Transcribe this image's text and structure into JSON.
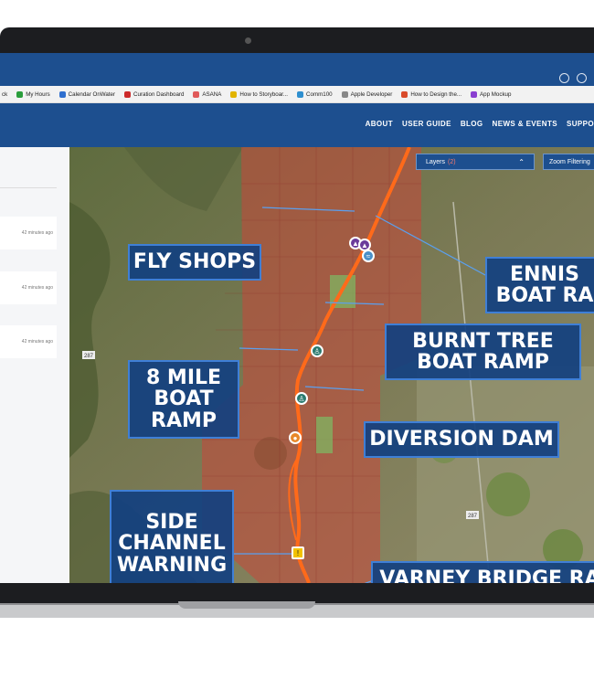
{
  "browser": {
    "bookmarks": [
      {
        "label": "ck",
        "color": "#1d4f8f"
      },
      {
        "label": "My Hours",
        "color": "#2a9d3c"
      },
      {
        "label": "Calendar OnWater",
        "color": "#2f6fcf"
      },
      {
        "label": "Curation Dashboard",
        "color": "#cc2a2a"
      },
      {
        "label": "ASANA",
        "color": "#e05a5a"
      },
      {
        "label": "How to Storyboar...",
        "color": "#e2b400"
      },
      {
        "label": "Comm100",
        "color": "#2f8fcf"
      },
      {
        "label": "Apple Developer",
        "color": "#888888"
      },
      {
        "label": "How to Design the...",
        "color": "#d94b2b"
      },
      {
        "label": "App Mockup",
        "color": "#8a3fd1"
      }
    ]
  },
  "nav": {
    "links": [
      "ABOUT",
      "USER GUIDE",
      "BLOG",
      "NEWS & EVENTS",
      "SUPPO"
    ]
  },
  "sidebar": {
    "items": [
      {
        "time": "42 minutes ago"
      },
      {
        "time": "42 minutes ago"
      },
      {
        "time": "42 minutes ago"
      }
    ]
  },
  "map": {
    "layers_label": "Layers",
    "layers_count": "(2)",
    "zoom_filter_label": "Zoom Filtering",
    "highway_labels": [
      "287",
      "287"
    ],
    "callouts": {
      "fly_shops": "FLY SHOPS",
      "ennis_boat_ramp": "ENNIS\nBOAT RA",
      "burnt_tree": "BURNT TREE\nBOAT RAMP",
      "eight_mile": "8 MILE\nBOAT\nRAMP",
      "diversion_dam": "DIVERSION DAM",
      "side_channel": "SIDE\nCHANNEL\nWARNING",
      "varney_bridge": "VARNEY BRIDGE RA"
    }
  },
  "colors": {
    "brand_blue": "#1d4f8f",
    "river": "#ff6a1a",
    "access_zone": "#c9473a",
    "terrain": "#5d6b3c"
  }
}
